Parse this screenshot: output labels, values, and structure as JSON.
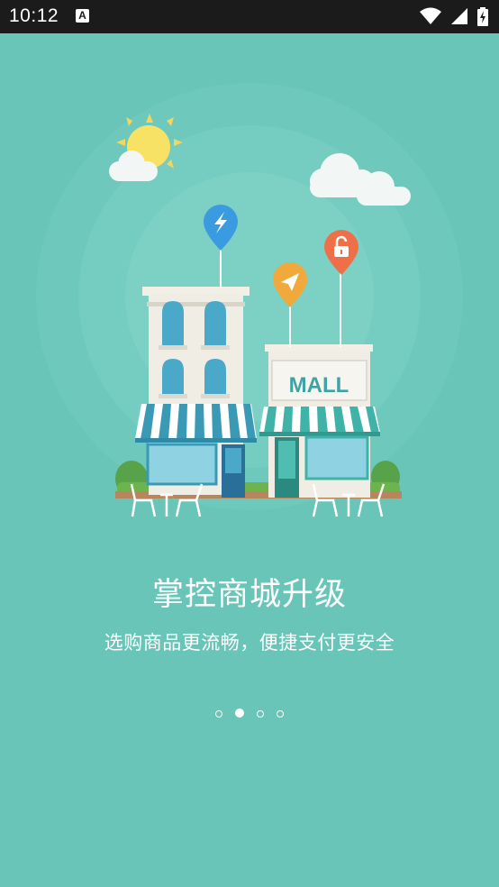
{
  "status_bar": {
    "time": "10:12",
    "notification_icon": "a-icon",
    "icons": [
      "wifi-icon",
      "signal-icon",
      "battery-charging-icon"
    ]
  },
  "onboarding": {
    "title": "掌控商城升级",
    "subtitle": "选购商品更流畅，便捷支付更安全",
    "mall_sign": "MALL",
    "pins": [
      "lightning-icon",
      "paper-plane-icon",
      "unlock-icon"
    ],
    "page_indicator": {
      "total": 4,
      "current": 2
    }
  },
  "colors": {
    "background": "#68c5b8",
    "status_bar": "#1b1b1b",
    "pin_blue": "#3a9be0",
    "pin_orange": "#f2a93b",
    "pin_red": "#ef7048"
  }
}
